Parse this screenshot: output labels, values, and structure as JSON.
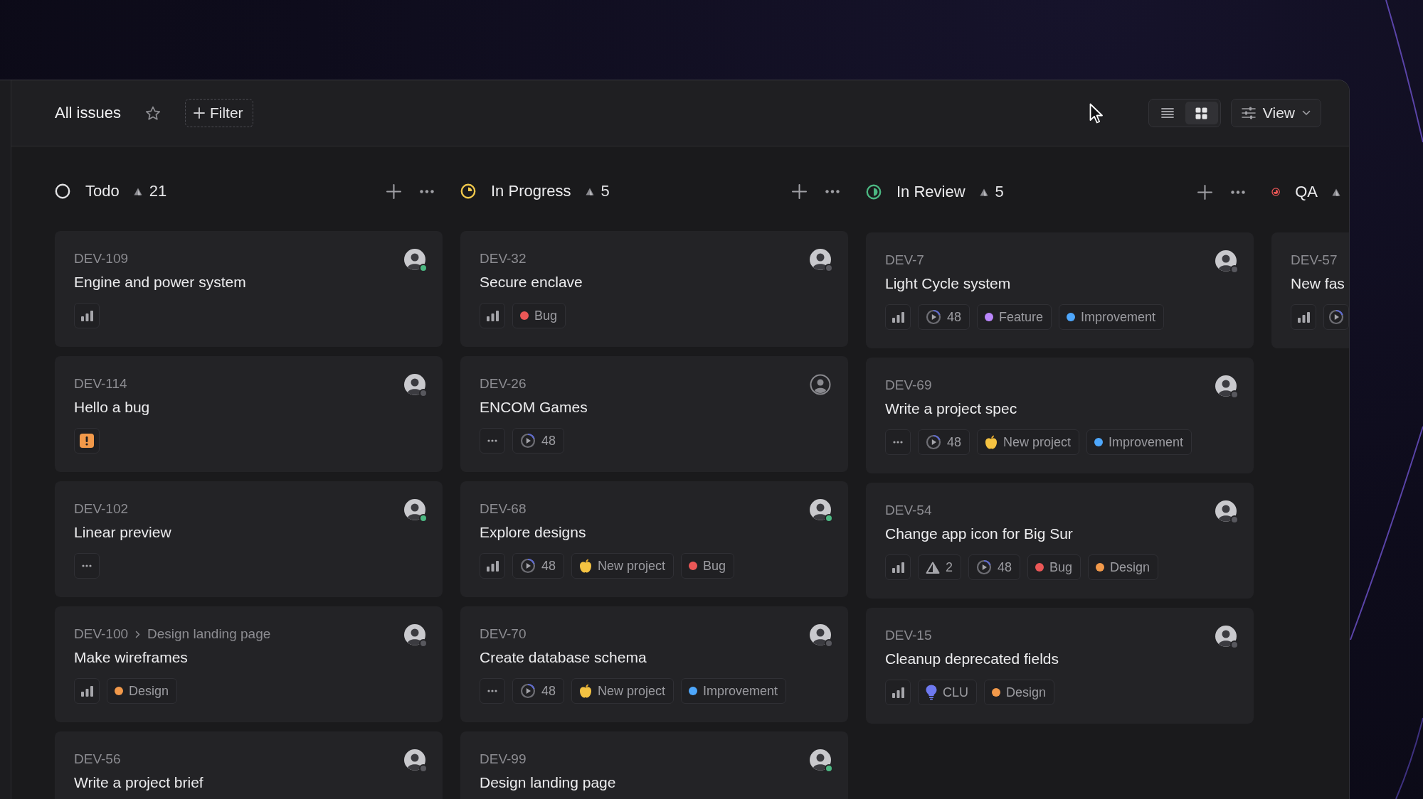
{
  "header": {
    "title": "All issues",
    "filter_button": "Filter",
    "view_toggle": [
      {
        "kind": "list",
        "selected": false
      },
      {
        "kind": "grid",
        "selected": true
      }
    ],
    "view_button": "View"
  },
  "columns": [
    {
      "title": "Todo",
      "kind": "todo",
      "color": "#e2e2e4",
      "count": "21",
      "actions": true,
      "cards": [
        {
          "id": "DEV-109",
          "title": "Engine and power system",
          "assignee": {
            "kind": "photo",
            "online": true
          },
          "tags": [
            {
              "kind": "priority"
            }
          ]
        },
        {
          "id": "DEV-114",
          "title": "Hello a bug",
          "assignee": {
            "kind": "photo",
            "online": false
          },
          "tags": [
            {
              "kind": "urgent"
            }
          ]
        },
        {
          "id": "DEV-102",
          "title": "Linear preview",
          "assignee": {
            "kind": "photo",
            "online": true
          },
          "tags": [
            {
              "kind": "nopriority"
            }
          ]
        },
        {
          "id": "DEV-100",
          "parent": "Design landing page",
          "title": "Make wireframes",
          "assignee": {
            "kind": "photo",
            "online": false
          },
          "tags": [
            {
              "kind": "priority"
            },
            {
              "kind": "label",
              "text": "Design",
              "color": "#f2994a"
            }
          ]
        },
        {
          "id": "DEV-56",
          "title": "Write a project brief",
          "assignee": {
            "kind": "photo",
            "online": false
          }
        }
      ]
    },
    {
      "title": "In Progress",
      "kind": "started",
      "color": "#f2c94c",
      "count": "5",
      "actions": true,
      "cards": [
        {
          "id": "DEV-32",
          "title": "Secure enclave",
          "assignee": {
            "kind": "photo",
            "online": false
          },
          "tags": [
            {
              "kind": "priority"
            },
            {
              "kind": "label",
              "text": "Bug",
              "color": "#eb5757"
            }
          ]
        },
        {
          "id": "DEV-26",
          "title": "ENCOM Games",
          "assignee": {
            "kind": "unassigned"
          },
          "tags": [
            {
              "kind": "nopriority"
            },
            {
              "kind": "cycle",
              "text": "48"
            }
          ]
        },
        {
          "id": "DEV-68",
          "title": "Explore designs",
          "assignee": {
            "kind": "photo",
            "online": true
          },
          "tags": [
            {
              "kind": "priority"
            },
            {
              "kind": "cycle",
              "text": "48"
            },
            {
              "kind": "project",
              "text": "New project"
            },
            {
              "kind": "label",
              "text": "Bug",
              "color": "#eb5757"
            }
          ]
        },
        {
          "id": "DEV-70",
          "title": "Create database schema",
          "assignee": {
            "kind": "photo",
            "online": false
          },
          "tags": [
            {
              "kind": "nopriority"
            },
            {
              "kind": "cycle",
              "text": "48"
            },
            {
              "kind": "project",
              "text": "New project"
            },
            {
              "kind": "label",
              "text": "Improvement",
              "color": "#4ea7fc"
            }
          ]
        },
        {
          "id": "DEV-99",
          "title": "Design landing page",
          "assignee": {
            "kind": "photo",
            "online": true
          }
        }
      ]
    },
    {
      "title": "In Review",
      "kind": "review",
      "color": "#4cb782",
      "count": "5",
      "actions": true,
      "cards": [
        {
          "id": "DEV-7",
          "title": "Light Cycle system",
          "assignee": {
            "kind": "photo",
            "online": false
          },
          "tags": [
            {
              "kind": "priority"
            },
            {
              "kind": "cycle",
              "text": "48"
            },
            {
              "kind": "label",
              "text": "Feature",
              "color": "#bb87fc"
            },
            {
              "kind": "label",
              "text": "Improvement",
              "color": "#4ea7fc"
            }
          ]
        },
        {
          "id": "DEV-69",
          "title": "Write a project spec",
          "assignee": {
            "kind": "photo",
            "online": false
          },
          "tags": [
            {
              "kind": "nopriority"
            },
            {
              "kind": "cycle",
              "text": "48"
            },
            {
              "kind": "project",
              "text": "New project"
            },
            {
              "kind": "label",
              "text": "Improvement",
              "color": "#4ea7fc"
            }
          ]
        },
        {
          "id": "DEV-54",
          "title": "Change app icon for Big Sur",
          "assignee": {
            "kind": "photo",
            "online": false
          },
          "tags": [
            {
              "kind": "priority"
            },
            {
              "kind": "estimate",
              "text": "2"
            },
            {
              "kind": "cycle",
              "text": "48"
            },
            {
              "kind": "label",
              "text": "Bug",
              "color": "#eb5757"
            },
            {
              "kind": "label",
              "text": "Design",
              "color": "#f2994a"
            }
          ]
        },
        {
          "id": "DEV-15",
          "title": "Cleanup deprecated fields",
          "assignee": {
            "kind": "photo",
            "online": false
          },
          "tags": [
            {
              "kind": "priority"
            },
            {
              "kind": "bulb",
              "text": "CLU"
            },
            {
              "kind": "label",
              "text": "Design",
              "color": "#f2994a"
            }
          ]
        }
      ]
    },
    {
      "title": "QA",
      "kind": "qa",
      "color": "#eb5757",
      "actions": false,
      "cards": [
        {
          "id": "DEV-57",
          "title": "New fas",
          "tags": [
            {
              "kind": "priority"
            },
            {
              "kind": "cycle"
            }
          ]
        }
      ]
    }
  ]
}
